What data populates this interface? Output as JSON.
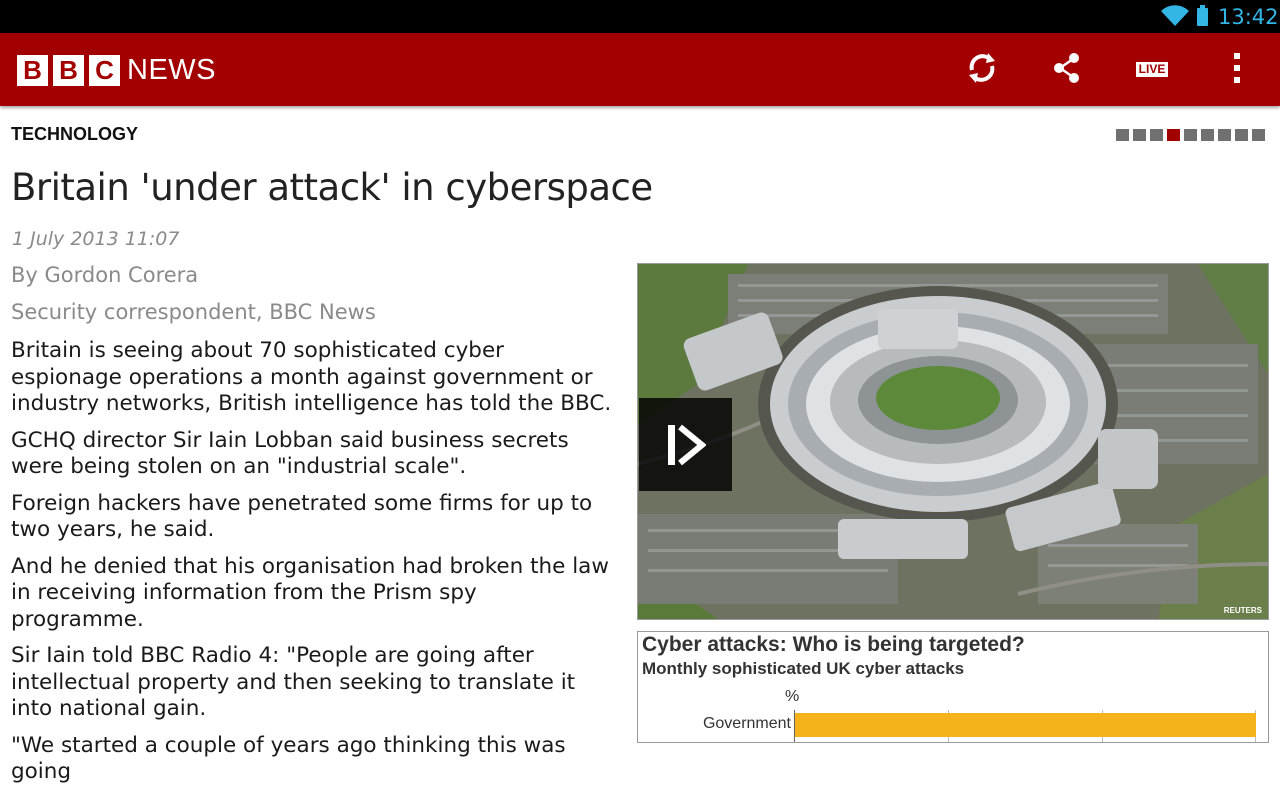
{
  "status_bar": {
    "time": "13:42",
    "icons": [
      "wifi-icon",
      "battery-icon"
    ]
  },
  "app_bar": {
    "logo_letters": [
      "B",
      "B",
      "C"
    ],
    "logo_word": "NEWS",
    "actions": [
      "refresh-icon",
      "share-icon",
      "live-icon",
      "overflow-menu-icon"
    ],
    "live_label": "LIVE",
    "colors": {
      "brand": "#a30101"
    }
  },
  "article": {
    "section": "TECHNOLOGY",
    "pager": {
      "total": 9,
      "active_index": 4
    },
    "title": "Britain 'under attack' in cyberspace",
    "date": "1 July 2013 11:07",
    "byline": "By Gordon Corera",
    "role": "Security correspondent, BBC News",
    "paragraphs": [
      "Britain is seeing about 70 sophisticated cyber espionage operations a month against government or industry networks, British intelligence has told the BBC.",
      "GCHQ director Sir Iain Lobban said business secrets were being stolen on an \"industrial scale\".",
      "Foreign hackers have penetrated some firms for up to two years, he said.",
      "And he denied that his organisation had broken the law in receiving information from the Prism spy programme.",
      "Sir Iain told BBC Radio 4: \"People are going after intellectual property and then seeking to translate it into national gain.",
      "\"We started a couple of years ago thinking this was going"
    ]
  },
  "media": {
    "photo_credit": "REUTERS",
    "play_icon": "play-video-icon"
  },
  "chart_data": {
    "type": "bar",
    "title": "Cyber attacks: Who is being targeted?",
    "subtitle": "Monthly sophisticated UK cyber attacks",
    "unit_label": "%",
    "categories": [
      "Government"
    ],
    "values": [
      100
    ],
    "bar_color": "#f6b21a"
  }
}
